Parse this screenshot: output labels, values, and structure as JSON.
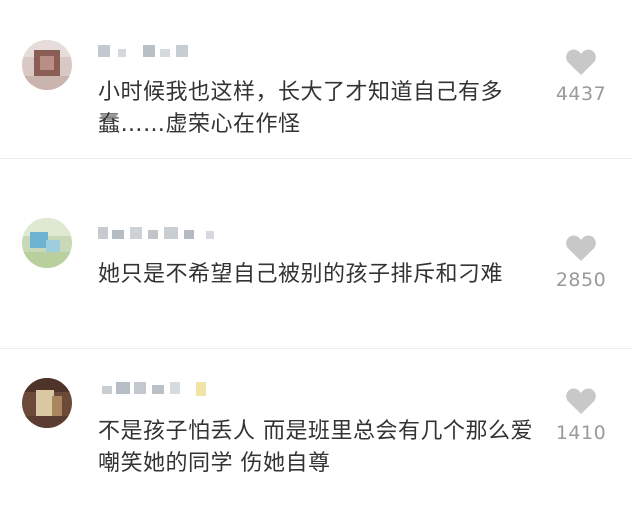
{
  "comments": [
    {
      "text": "小时候我也这样，长大了才知道自己有多蠢……虚荣心在作怪",
      "likes": "4437",
      "avatar_icon": "user-avatar-blurred"
    },
    {
      "text": "她只是不希望自己被别的孩子排斥和刁难",
      "likes": "2850",
      "avatar_icon": "user-avatar-blurred"
    },
    {
      "text": "不是孩子怕丢人 而是班里总会有几个那么爱嘲笑她的同学 伤她自尊",
      "likes": "1410",
      "avatar_icon": "user-avatar-blurred"
    }
  ],
  "colors": {
    "text": "#333333",
    "like_count": "#9a9a9a",
    "like_icon": "#c8c8c8",
    "divider": "#ececec"
  },
  "icons": {
    "like": "heart-icon"
  }
}
